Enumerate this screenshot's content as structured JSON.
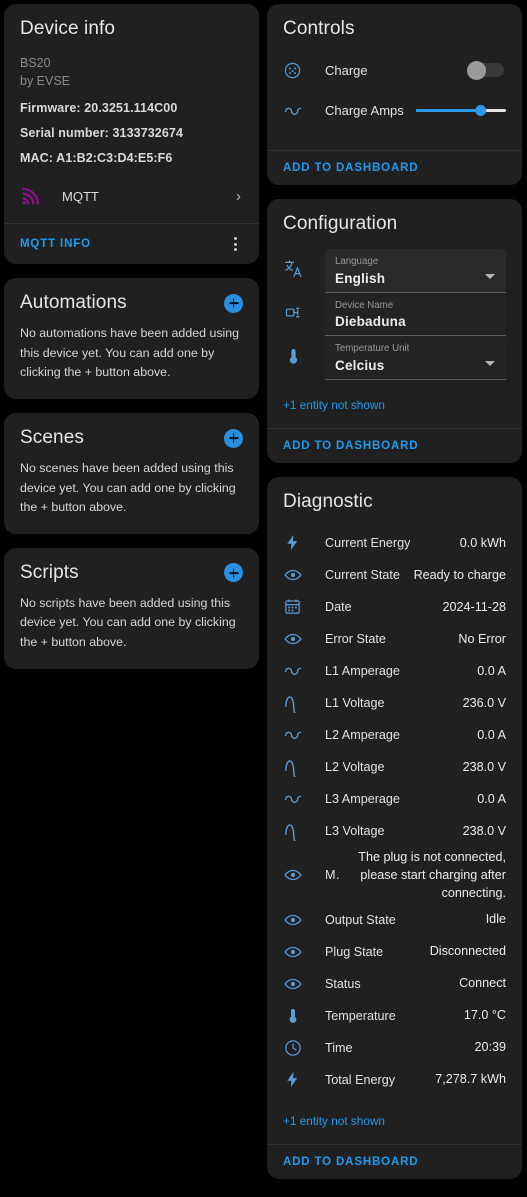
{
  "device_info": {
    "title": "Device info",
    "model": "BS20",
    "manufacturer": "by EVSE",
    "firmware": "Firmware: 20.3251.114C00",
    "serial": "Serial number: 3133732674",
    "mac": "MAC: A1:B2:C3:D4:E5:F6",
    "integration_name": "MQTT",
    "info_link": "MQTT INFO"
  },
  "automations": {
    "title": "Automations",
    "empty": "No automations have been added using this device yet. You can add one by clicking the + button above."
  },
  "scenes": {
    "title": "Scenes",
    "empty": "No scenes have been added using this device yet. You can add one by clicking the + button above."
  },
  "scripts": {
    "title": "Scripts",
    "empty": "No scripts have been added using this device yet. You can add one by clicking the + button above."
  },
  "controls": {
    "title": "Controls",
    "add_to_dashboard": "ADD TO DASHBOARD",
    "rows": [
      {
        "icon": "ev-plug-icon",
        "label": "Charge",
        "type": "toggle",
        "value": "off"
      },
      {
        "icon": "current-ac-icon",
        "label": "Charge Amps",
        "type": "slider",
        "percent": 72
      }
    ]
  },
  "configuration": {
    "title": "Configuration",
    "add_to_dashboard": "ADD TO DASHBOARD",
    "entity_note": "+1 entity not shown",
    "fields": [
      {
        "icon": "translate-icon",
        "label": "Language",
        "value": "English",
        "type": "select"
      },
      {
        "icon": "rename-device-icon",
        "label": "Device Name",
        "value": "Diebaduna",
        "type": "text"
      },
      {
        "icon": "thermometer-icon",
        "label": "Temperature Unit",
        "value": "Celcius",
        "type": "select"
      }
    ]
  },
  "diagnostic": {
    "title": "Diagnostic",
    "add_to_dashboard": "ADD TO DASHBOARD",
    "entity_note": "+1 entity not shown",
    "rows": [
      {
        "icon": "lightning-bolt-icon",
        "name": "Current Energy",
        "value": "0.0 kWh"
      },
      {
        "icon": "eye-icon",
        "name": "Current State",
        "value": "Ready to charge"
      },
      {
        "icon": "calendar-icon",
        "name": "Date",
        "value": "2024-11-28"
      },
      {
        "icon": "eye-icon",
        "name": "Error State",
        "value": "No Error"
      },
      {
        "icon": "current-ac-icon",
        "name": "L1 Amperage",
        "value": "0.0 A"
      },
      {
        "icon": "sine-wave-icon",
        "name": "L1 Voltage",
        "value": "236.0 V"
      },
      {
        "icon": "current-ac-icon",
        "name": "L2 Amperage",
        "value": "0.0 A"
      },
      {
        "icon": "sine-wave-icon",
        "name": "L2 Voltage",
        "value": "238.0 V"
      },
      {
        "icon": "current-ac-icon",
        "name": "L3 Amperage",
        "value": "0.0 A"
      },
      {
        "icon": "sine-wave-icon",
        "name": "L3 Voltage",
        "value": "238.0 V"
      },
      {
        "icon": "eye-icon",
        "name": "Mes…",
        "value": "The plug is not connected, please start charging after connecting.",
        "multiline": true
      },
      {
        "icon": "eye-icon",
        "name": "Output State",
        "value": "Idle"
      },
      {
        "icon": "eye-icon",
        "name": "Plug State",
        "value": "Disconnected"
      },
      {
        "icon": "eye-icon",
        "name": "Status",
        "value": "Connect"
      },
      {
        "icon": "thermometer-icon",
        "name": "Temperature",
        "value": "17.0 °C"
      },
      {
        "icon": "clock-icon",
        "name": "Time",
        "value": "20:39"
      },
      {
        "icon": "lightning-bolt-icon",
        "name": "Total Energy",
        "value": "7,278.7 kWh"
      }
    ]
  },
  "colors": {
    "accent": "#1f9bf0",
    "card": "#202020",
    "background": "#000000",
    "icon_blue": "#5a9bd4",
    "mqtt_purple": "#8e0f8e"
  }
}
